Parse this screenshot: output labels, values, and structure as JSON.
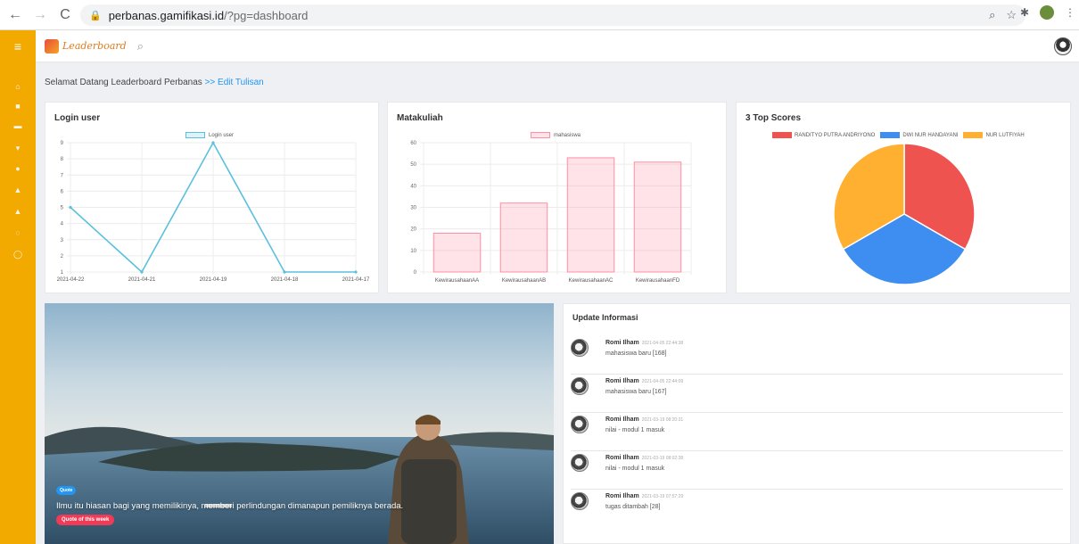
{
  "browser": {
    "back": "←",
    "forward": "→",
    "reload": "C",
    "url_host": "perbanas.gamifikasi.id",
    "url_path": "/?pg=dashboard"
  },
  "header": {
    "logo_text": "Leaderboard",
    "search_icon": "search-icon"
  },
  "breadcrumb": {
    "text": "Selamat Datang Leaderboard Perbanas ",
    "link": ">> Edit Tulisan"
  },
  "cards": {
    "login": {
      "title": "Login user",
      "legend": "Login user"
    },
    "matakuliah": {
      "title": "Matakuliah",
      "legend": "mahasiswa"
    },
    "top": {
      "title": "3 Top Scores",
      "legends": [
        "RANDITYO PUTRA ANDRIYONO",
        "DWI NUR HANDAYANI",
        "NUR LUTFIYAH"
      ]
    }
  },
  "chart_data": [
    {
      "type": "line",
      "title": "Login user",
      "x": [
        "2021-04-22",
        "2021-04-21",
        "2021-04-19",
        "2021-04-18",
        "2021-04-17"
      ],
      "series": [
        {
          "name": "Login user",
          "values": [
            5,
            1,
            9,
            1,
            1
          ]
        }
      ],
      "ylim": [
        1,
        9
      ],
      "yticks": [
        1,
        2,
        3,
        4,
        5,
        6,
        7,
        8,
        9
      ],
      "color": "#5bc0de"
    },
    {
      "type": "bar",
      "title": "Matakuliah",
      "categories": [
        "KewirausahaanAA",
        "KewirausahaanAB",
        "KewirausahaanAC",
        "KewirausahaanFD"
      ],
      "series": [
        {
          "name": "mahasiswa",
          "values": [
            18,
            32,
            53,
            51
          ]
        }
      ],
      "ylim": [
        0,
        60
      ],
      "yticks": [
        0,
        10,
        20,
        30,
        40,
        50,
        60
      ],
      "color": "#ff8fa3"
    },
    {
      "type": "pie",
      "title": "3 Top Scores",
      "categories": [
        "RANDITYO PUTRA ANDRIYONO",
        "DWI NUR HANDAYANI",
        "NUR LUTFIYAH"
      ],
      "values": [
        1,
        1,
        1
      ],
      "colors": [
        "#ef5350",
        "#3d8ef0",
        "#ffb030"
      ]
    }
  ],
  "quote": {
    "badge": "Quote",
    "text": "Ilmu itu hiasan bagi yang memilikinya, memberi perlindungan dimanapun pemiliknya berada.",
    "button": "Quote of this week"
  },
  "updates": {
    "title": "Update Informasi",
    "items": [
      {
        "name": "Romi Ilham",
        "time": "2021-04-05 22:44:38",
        "msg": "mahasiswa baru [168]"
      },
      {
        "name": "Romi Ilham",
        "time": "2021-04-05 22:44:09",
        "msg": "mahasiswa baru [167]"
      },
      {
        "name": "Romi Ilham",
        "time": "2021-03-19 08:20:31",
        "msg": "nilai - modul 1 masuk"
      },
      {
        "name": "Romi Ilham",
        "time": "2021-03-19 08:02:38",
        "msg": "nilai - modul 1 masuk"
      },
      {
        "name": "Romi Ilham",
        "time": "2021-03-19 07:57:29",
        "msg": "tugas ditambah [28]"
      }
    ]
  }
}
